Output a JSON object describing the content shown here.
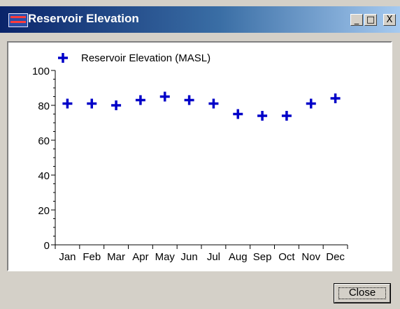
{
  "window": {
    "title": "Reservoir Elevation",
    "minimize_glyph": "_",
    "maximize_glyph": "□",
    "close_glyph": "X"
  },
  "buttons": {
    "close_label": "Close"
  },
  "chart_data": {
    "type": "scatter",
    "marker": "plus",
    "marker_color": "#0000c8",
    "categories": [
      "Jan",
      "Feb",
      "Mar",
      "Apr",
      "May",
      "Jun",
      "Jul",
      "Aug",
      "Sep",
      "Oct",
      "Nov",
      "Dec"
    ],
    "series": [
      {
        "name": "Reservoir Elevation (MASL)",
        "values": [
          81,
          81,
          80,
          83,
          85,
          83,
          81,
          75,
          74,
          74,
          81,
          84
        ]
      }
    ],
    "ylim": [
      0,
      100
    ],
    "yticks": [
      0,
      20,
      40,
      60,
      80,
      100
    ],
    "grid": false,
    "legend": "top-left"
  }
}
